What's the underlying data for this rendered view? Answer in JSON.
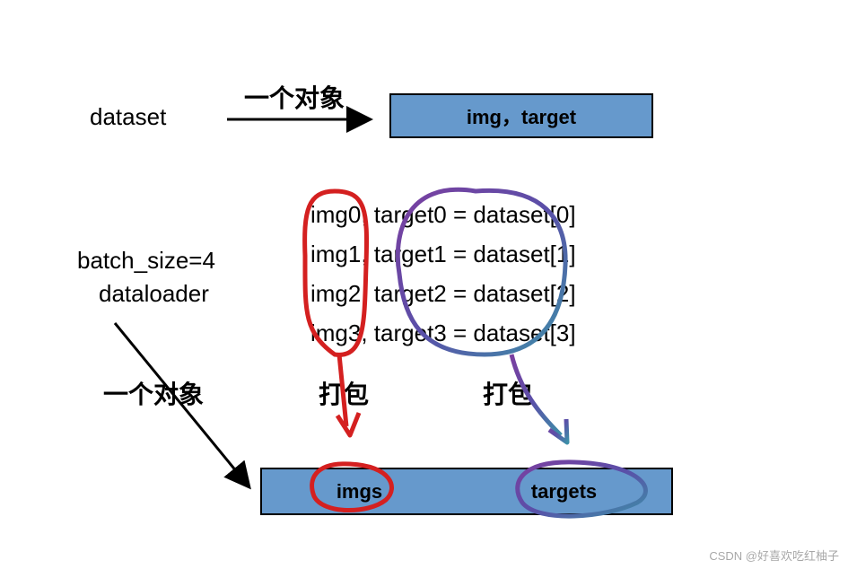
{
  "labels": {
    "dataset": "dataset",
    "one_object_top": "一个对象",
    "batch_size": "batch_size=4",
    "dataloader": "dataloader",
    "one_object_left": "一个对象",
    "pack_left": "打包",
    "pack_right": "打包"
  },
  "boxes": {
    "top": "img，target",
    "bottom_left": "imgs",
    "bottom_right": "targets"
  },
  "code": {
    "line1": "img0, target0 = dataset[0]",
    "line2": "img1, target1 = dataset[1]",
    "line3": "img2, target2 = dataset[2]",
    "line4": "img3, target3 = dataset[3]"
  },
  "watermark": "CSDN @好喜欢吃红柚子"
}
